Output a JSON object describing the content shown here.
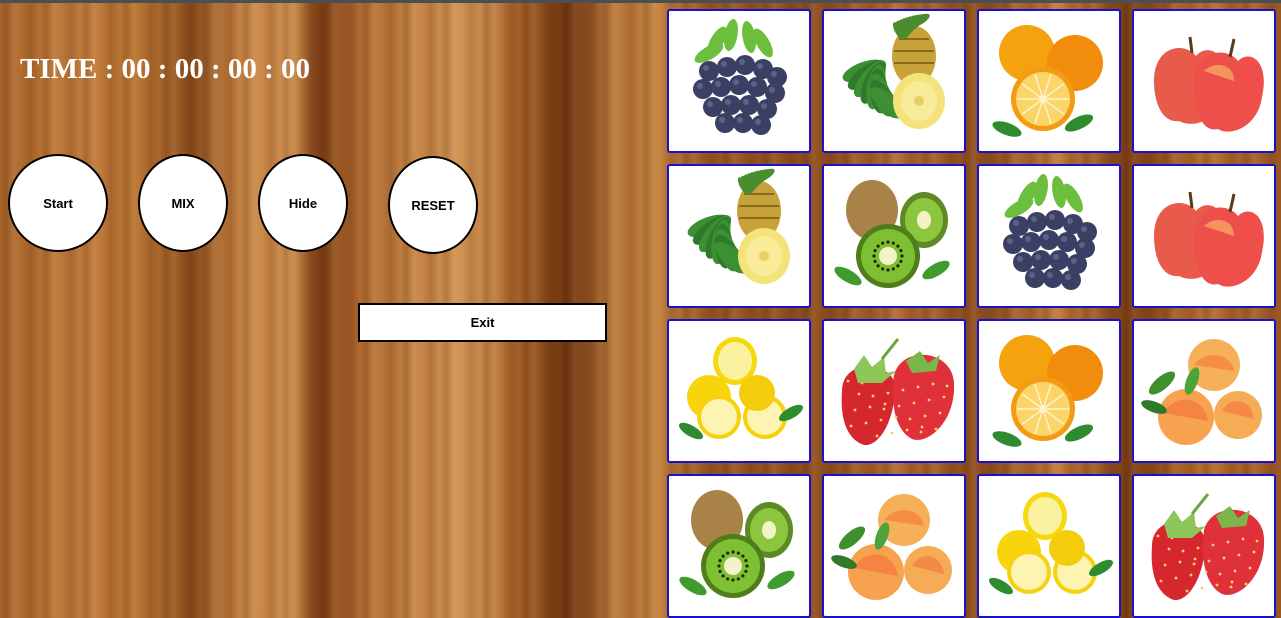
{
  "timer": {
    "label": "TIME",
    "hours": "00",
    "minutes": "00",
    "seconds": "00",
    "centis": "00"
  },
  "buttons": {
    "start": "Start",
    "mix": "MIX",
    "hide": "Hide",
    "reset": "RESET",
    "exit": "Exit"
  },
  "colors": {
    "card_border": "#1a12c8",
    "card_bg": "#ffffff",
    "timer_text": "#ffffff"
  },
  "cards": [
    {
      "fruit": "blueberry-icon"
    },
    {
      "fruit": "pineapple-icon"
    },
    {
      "fruit": "orange-icon"
    },
    {
      "fruit": "apple-icon"
    },
    {
      "fruit": "pineapple-icon"
    },
    {
      "fruit": "kiwi-icon"
    },
    {
      "fruit": "blueberry-icon"
    },
    {
      "fruit": "apple-icon"
    },
    {
      "fruit": "lemon-icon"
    },
    {
      "fruit": "strawberry-icon"
    },
    {
      "fruit": "orange-icon"
    },
    {
      "fruit": "peach-icon"
    },
    {
      "fruit": "kiwi-icon"
    },
    {
      "fruit": "peach-icon"
    },
    {
      "fruit": "lemon-icon"
    },
    {
      "fruit": "strawberry-icon"
    }
  ]
}
